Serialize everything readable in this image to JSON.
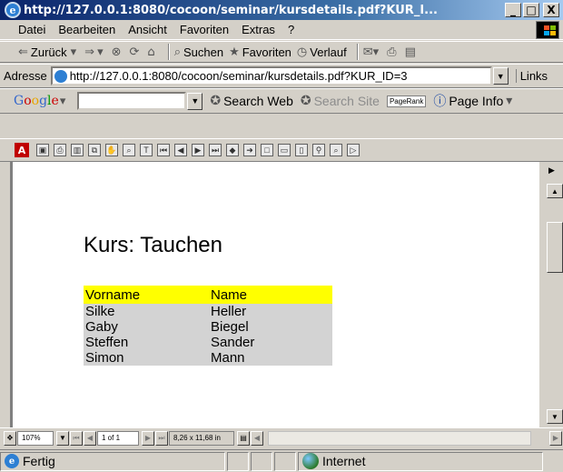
{
  "window": {
    "title": "http://127.0.0.1:8080/cocoon/seminar/kursdetails.pdf?KUR_I...",
    "minimize": "_",
    "maximize": "□",
    "close": "X"
  },
  "menu": [
    "Datei",
    "Bearbeiten",
    "Ansicht",
    "Favoriten",
    "Extras",
    "?"
  ],
  "standard_toolbar": {
    "back": "Zurück",
    "search": "Suchen",
    "favorites": "Favoriten",
    "history": "Verlauf"
  },
  "address": {
    "label": "Adresse",
    "url": "http://127.0.0.1:8080/cocoon/seminar/kursdetails.pdf?KUR_ID=3",
    "links": "Links"
  },
  "google_toolbar": {
    "logo": "Google",
    "search_web": "Search Web",
    "search_site": "Search Site",
    "pagerank": "PageRank",
    "page_info": "Page Info"
  },
  "pdf": {
    "title": "Kurs: Tauchen",
    "headers": [
      "Vorname",
      "Name"
    ],
    "rows": [
      [
        "Silke",
        "Heller"
      ],
      [
        "Gaby",
        "Biegel"
      ],
      [
        "Steffen",
        "Sander"
      ],
      [
        "Simon",
        "Mann"
      ]
    ]
  },
  "pdf_status": {
    "zoom": "107%",
    "page": "1 of 1",
    "size": "8,26 x 11,68 in"
  },
  "statusbar": {
    "status": "Fertig",
    "zone": "Internet"
  },
  "colors": {
    "header_bg": "#ffff00",
    "row_bg": "#d3d3d3"
  }
}
